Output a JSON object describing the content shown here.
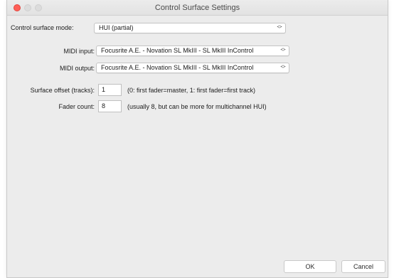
{
  "window": {
    "title": "Control Surface Settings"
  },
  "mode": {
    "label": "Control surface mode:",
    "value": "HUI (partial)"
  },
  "midi_input": {
    "label": "MIDI input:",
    "value": "Focusrite A.E. - Novation SL MkIII - SL MkIII InControl"
  },
  "midi_output": {
    "label": "MIDI output:",
    "value": "Focusrite A.E. - Novation SL MkIII - SL MkIII InControl"
  },
  "surface_offset": {
    "label": "Surface offset (tracks):",
    "value": "1",
    "hint": "(0: first fader=master, 1: first fader=first track)"
  },
  "fader_count": {
    "label": "Fader count:",
    "value": "8",
    "hint": "(usually 8, but can be more for multichannel HUI)"
  },
  "buttons": {
    "ok": "OK",
    "cancel": "Cancel"
  },
  "colors": {
    "close": "#ff5f57",
    "background": "#ececec",
    "field": "#ffffff"
  }
}
